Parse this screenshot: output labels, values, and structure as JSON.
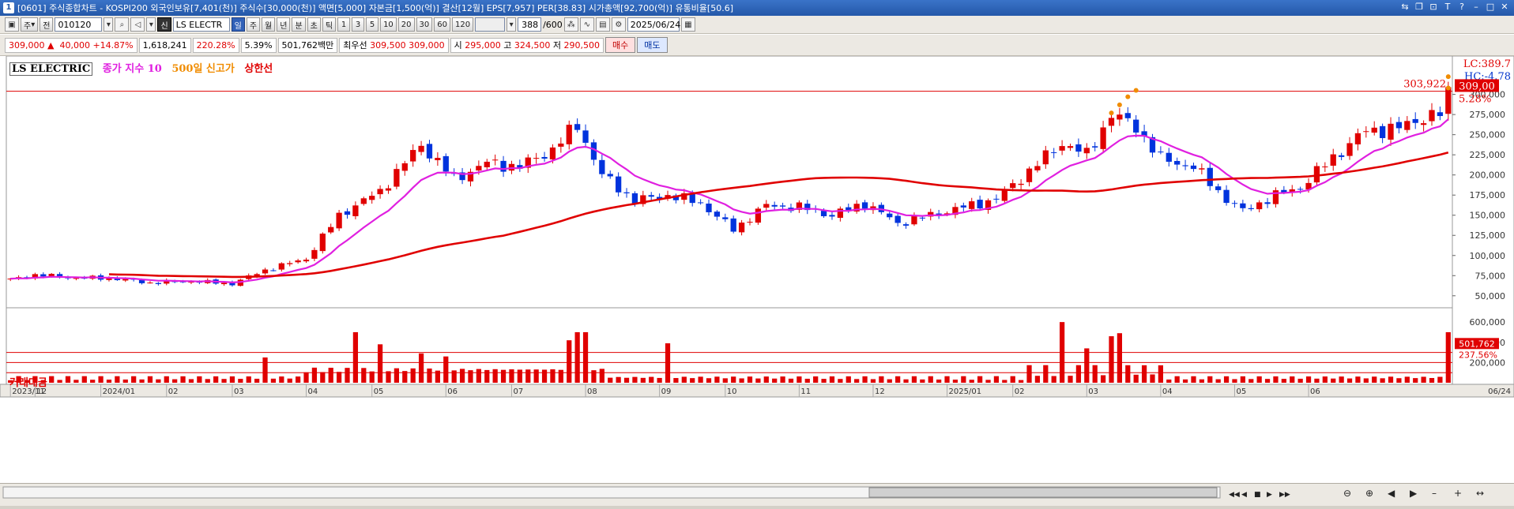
{
  "window": {
    "number": "1",
    "title": "[0601] 주식종합차트 - KOSPI200 외국인보유[7,401(천)] 주식수[30,000(천)] 액면[5,000] 자본금[1,500(억)] 결산[12월] EPS[7,957] PER[38.83] 시가총액[92,700(억)] 유통비율[50.6]"
  },
  "toolbar": {
    "jeon_label": "전",
    "period_label": "주",
    "code": "010120",
    "name_badge": "신",
    "name": "LS ELECTR",
    "period_buttons": [
      "일",
      "주",
      "월",
      "년",
      "분",
      "초",
      "틱"
    ],
    "interval_buttons": [
      "1",
      "3",
      "5",
      "10",
      "20",
      "30",
      "60",
      "120"
    ],
    "count": "388",
    "count_total": "/600",
    "date": "2025/06/24"
  },
  "price_bar": {
    "price": "309,000",
    "change": "40,000",
    "change_pct": "+14.87%",
    "volume": "1,618,241",
    "volume_ratio": "220.28%",
    "turnover": "5.39%",
    "amount": "501,762백만",
    "preferred_label": "최우선",
    "ask": "309,500",
    "bid": "309,000",
    "open_label": "시",
    "open": "295,000",
    "high_label": "고",
    "high": "324,500",
    "low_label": "저",
    "low": "290,500",
    "buy_label": "매수",
    "sell_label": "매도"
  },
  "chart_data": [
    {
      "type": "line",
      "subtype": "candlestick",
      "legend": [
        {
          "name": "LS ELECTRIC",
          "color": "#000000"
        },
        {
          "name": "종가 지수 10",
          "color": "#e020e0"
        },
        {
          "name": "500일 신고가",
          "color": "#f08c00"
        },
        {
          "name": "상한선",
          "color": "#e00000"
        }
      ],
      "y_ticks": [
        "300,000",
        "275,000",
        "250,000",
        "225,000",
        "200,000",
        "175,000",
        "150,000",
        "125,000",
        "100,000",
        "75,000",
        "50,000"
      ],
      "ylim": [
        40000,
        330000
      ],
      "x_labels": [
        "2023/11",
        "12",
        "2024/01",
        "02",
        "03",
        "04",
        "05",
        "06",
        "07",
        "08",
        "09",
        "10",
        "11",
        "12",
        "2025/01",
        "02",
        "03",
        "04",
        "05",
        "06"
      ],
      "x_label_positions": [
        0,
        3,
        11,
        19,
        27,
        36,
        44,
        53,
        61,
        70,
        79,
        87,
        96,
        105,
        114,
        122,
        131,
        140,
        149,
        158
      ],
      "n_points": 176,
      "ma500_start_index": 12,
      "hline_value": 303922,
      "hline_label": "303,922",
      "last_price_label": "309,00",
      "last_pct_label": "5.28%",
      "lc_label": "LC:389.7",
      "hc_label": "HC:-4.78",
      "anchors": [
        [
          0,
          70000
        ],
        [
          3,
          76000
        ],
        [
          8,
          72000
        ],
        [
          12,
          72000
        ],
        [
          17,
          66000
        ],
        [
          22,
          68000
        ],
        [
          27,
          65000
        ],
        [
          31,
          82000
        ],
        [
          36,
          96000
        ],
        [
          40,
          150000
        ],
        [
          45,
          180000
        ],
        [
          50,
          238000
        ],
        [
          54,
          195000
        ],
        [
          58,
          215000
        ],
        [
          62,
          210000
        ],
        [
          66,
          232000
        ],
        [
          69,
          262000
        ],
        [
          72,
          200000
        ],
        [
          76,
          168000
        ],
        [
          80,
          175000
        ],
        [
          84,
          165000
        ],
        [
          88,
          132000
        ],
        [
          92,
          162000
        ],
        [
          96,
          160000
        ],
        [
          100,
          150000
        ],
        [
          104,
          165000
        ],
        [
          108,
          140000
        ],
        [
          112,
          150000
        ],
        [
          116,
          160000
        ],
        [
          120,
          170000
        ],
        [
          124,
          205000
        ],
        [
          128,
          240000
        ],
        [
          131,
          225000
        ],
        [
          134,
          275000
        ],
        [
          137,
          260000
        ],
        [
          140,
          220000
        ],
        [
          144,
          210000
        ],
        [
          148,
          170000
        ],
        [
          150,
          155000
        ],
        [
          154,
          175000
        ],
        [
          157,
          185000
        ],
        [
          161,
          222000
        ],
        [
          165,
          255000
        ],
        [
          169,
          258000
        ],
        [
          172,
          272000
        ],
        [
          174,
          275000
        ],
        [
          175,
          309000
        ]
      ],
      "new_high_marks": [
        [
          134,
          277000
        ],
        [
          135,
          287000
        ],
        [
          136,
          297000
        ],
        [
          137,
          305000
        ],
        [
          175,
          308000
        ],
        [
          175,
          322000
        ]
      ]
    },
    {
      "type": "bar",
      "title": "거래대금",
      "y_ticks": [
        "600,000",
        "400,000",
        "200,000"
      ],
      "ylim": [
        0,
        640000
      ],
      "hlines": [
        100000,
        200000,
        300000
      ],
      "last_label": "501,762",
      "last_pct": "237.56%",
      "spikes": [
        [
          31,
          250000
        ],
        [
          42,
          500000
        ],
        [
          45,
          380000
        ],
        [
          50,
          290000
        ],
        [
          53,
          260000
        ],
        [
          68,
          420000
        ],
        [
          69,
          500000
        ],
        [
          70,
          500000
        ],
        [
          80,
          390000
        ],
        [
          128,
          600000
        ],
        [
          131,
          340000
        ],
        [
          134,
          460000
        ],
        [
          135,
          490000
        ],
        [
          175,
          500000
        ]
      ]
    }
  ],
  "bottom": {
    "date_label": "06/24"
  }
}
